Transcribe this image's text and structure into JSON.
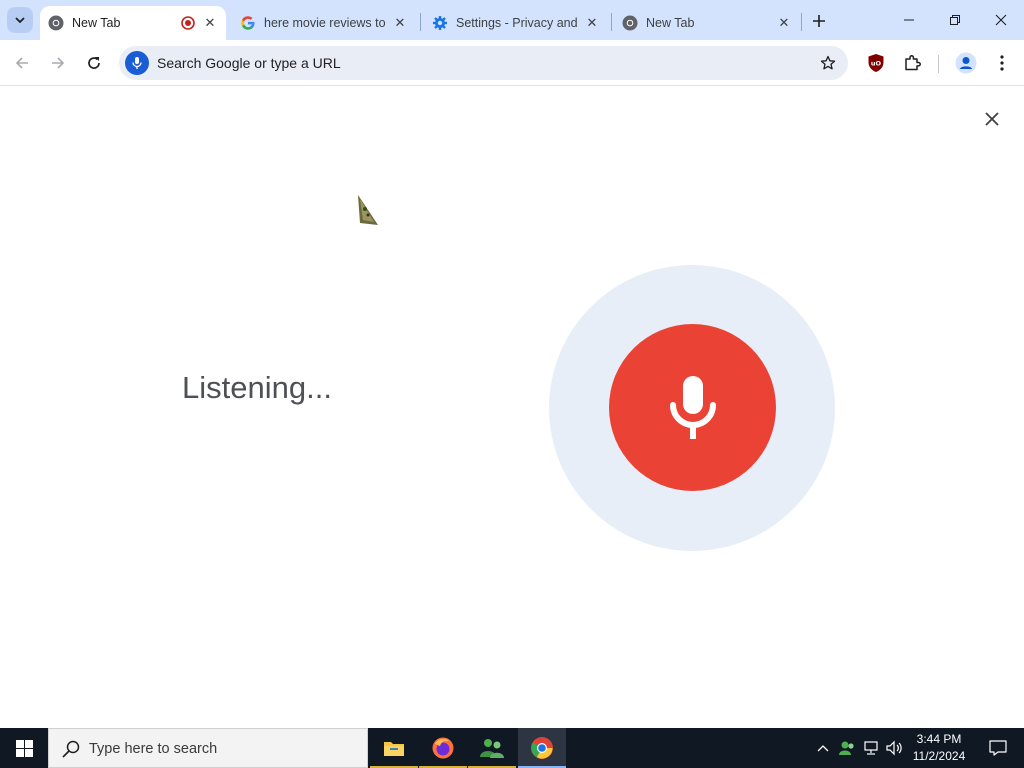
{
  "browser": {
    "tabs": [
      {
        "title": "New Tab",
        "favicon": "chrome-icon",
        "active": true,
        "recording": true
      },
      {
        "title": "here movie reviews to",
        "favicon": "google-g-icon",
        "active": false
      },
      {
        "title": "Settings - Privacy and",
        "favicon": "settings-gear-icon",
        "active": false
      },
      {
        "title": "New Tab",
        "favicon": "chrome-icon",
        "active": false
      }
    ],
    "omnibox": {
      "placeholder": "Search Google or type a URL"
    }
  },
  "voice_search": {
    "status": "Listening..."
  },
  "taskbar": {
    "search_placeholder": "Type here to search",
    "apps": [
      "file-explorer-icon",
      "firefox-icon",
      "people-app-icon",
      "chrome-icon"
    ],
    "clock": {
      "time": "3:44 PM",
      "date": "11/2/2024"
    }
  },
  "colors": {
    "tabstrip": "#d3e3fd",
    "mic_red": "#ea4335",
    "mic_halo": "#e8eef7",
    "taskbar": "#101823"
  }
}
